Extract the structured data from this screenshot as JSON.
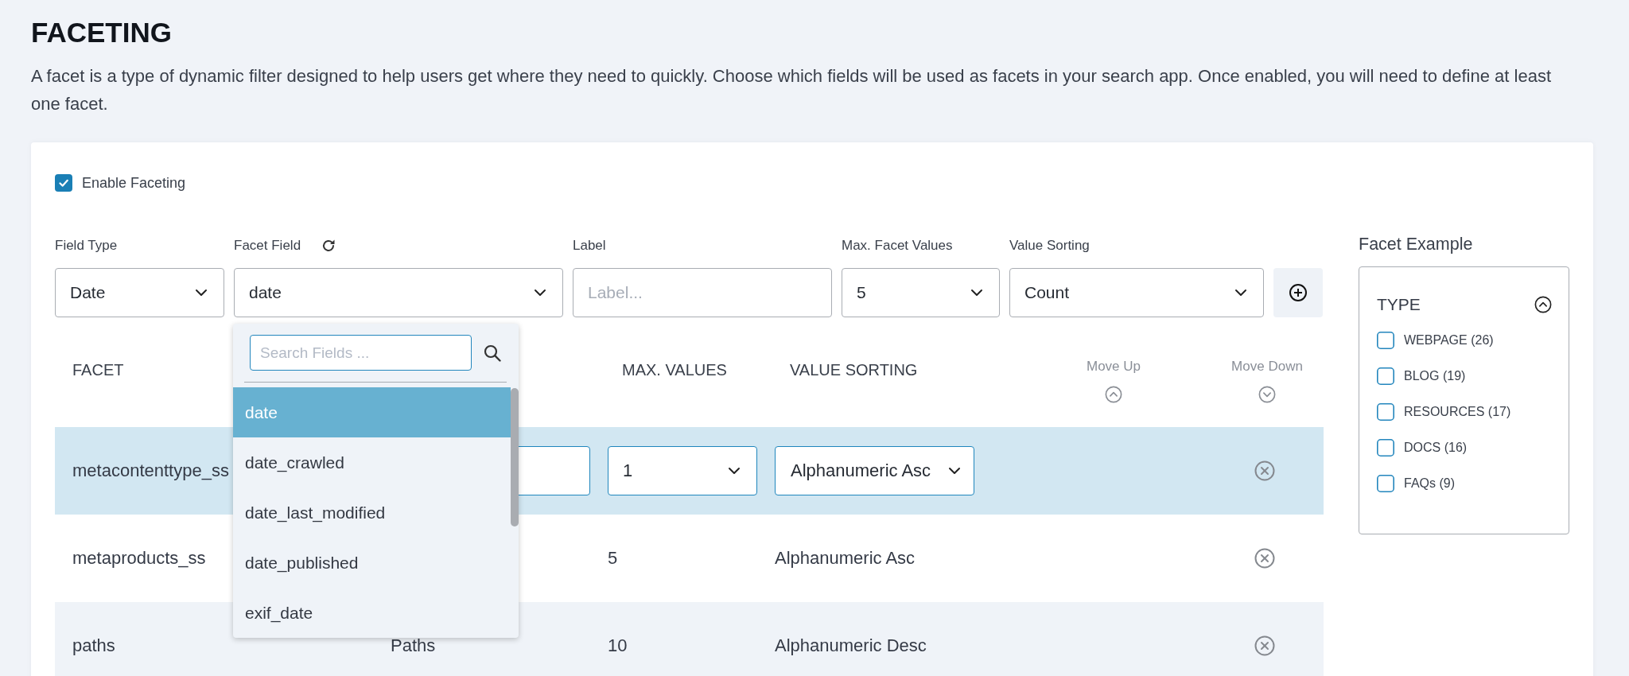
{
  "title": "FACETING",
  "description": "A facet is a type of dynamic filter designed to help users get where they need to quickly. Choose which fields will be used as facets in your search app. Once enabled, you will need to define at least one facet.",
  "enable_faceting": {
    "label": "Enable Faceting",
    "checked": true
  },
  "form": {
    "field_type": {
      "label": "Field Type",
      "value": "Date"
    },
    "facet_field": {
      "label": "Facet Field",
      "value": "date",
      "expanded": true,
      "search": {
        "placeholder": "Search Fields ..."
      },
      "options": [
        {
          "label": "date",
          "selected": true
        },
        {
          "label": "date_crawled",
          "selected": false
        },
        {
          "label": "date_last_modified",
          "selected": false
        },
        {
          "label": "date_published",
          "selected": false
        },
        {
          "label": "exif_date",
          "selected": false
        }
      ]
    },
    "label": {
      "label": "Label",
      "placeholder": "Label..."
    },
    "max_facet_values": {
      "label": "Max. Facet Values",
      "value": "5"
    },
    "value_sorting": {
      "label": "Value Sorting",
      "value": "Count"
    }
  },
  "table": {
    "headers": {
      "facet": "FACET",
      "max_values": "MAX. VALUES",
      "value_sorting": "VALUE SORTING",
      "move_up": "Move Up",
      "move_down": "Move Down"
    },
    "rows": [
      {
        "kind": "editing",
        "selected": true,
        "facet": "metacontenttype_ss",
        "max_values": "1",
        "value_sorting": "Alphanumeric Asc"
      },
      {
        "kind": "static",
        "selected": false,
        "facet": "metaproducts_ss",
        "max_values": "5",
        "value_sorting": "Alphanumeric Asc"
      },
      {
        "kind": "static",
        "selected": false,
        "facet": "paths",
        "column_2": "Paths",
        "max_values": "10",
        "value_sorting": "Alphanumeric Desc"
      }
    ]
  },
  "facet_example": {
    "title": "Facet Example",
    "group": {
      "label": "TYPE",
      "expanded": true,
      "options": [
        {
          "label": "WEBPAGE (26)",
          "checked": false
        },
        {
          "label": "BLOG (19)",
          "checked": false
        },
        {
          "label": "RESOURCES (17)",
          "checked": false
        },
        {
          "label": "DOCS (16)",
          "checked": false
        },
        {
          "label": "FAQs (9)",
          "checked": false
        }
      ]
    }
  }
}
